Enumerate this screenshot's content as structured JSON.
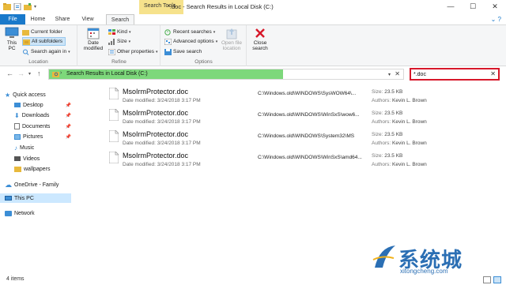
{
  "window": {
    "title": "*.doc - Search Results in Local Disk (C:)",
    "context_tab_group": "Search Tools",
    "controls": {
      "minimize": "—",
      "maximize": "☐",
      "close": "✕"
    }
  },
  "tabs": {
    "file": "File",
    "home": "Home",
    "share": "Share",
    "view": "View",
    "search": "Search"
  },
  "ribbon": {
    "location": {
      "label": "Location",
      "this_pc": "This PC",
      "current_folder": "Current folder",
      "all_subfolders": "All subfolders",
      "search_again_in": "Search again in"
    },
    "refine": {
      "label": "Refine",
      "date_modified": "Date modified",
      "kind": "Kind",
      "size": "Size",
      "other_properties": "Other properties"
    },
    "options": {
      "label": "Options",
      "recent_searches": "Recent searches",
      "advanced_options": "Advanced options",
      "save_search": "Save search",
      "open_file_location": "Open file location"
    },
    "close": {
      "close_search": "Close search"
    }
  },
  "address": {
    "path": "Search Results in Local Disk (C:)",
    "search_value": "*.doc",
    "clear_glyph": "✕",
    "progress_fraction": 0.66
  },
  "nav_pane": {
    "items": [
      {
        "label": "Quick access",
        "icon": "star-icon"
      },
      {
        "label": "Desktop",
        "icon": "desktop-icon",
        "pinned": true
      },
      {
        "label": "Downloads",
        "icon": "downloads-icon",
        "pinned": true
      },
      {
        "label": "Documents",
        "icon": "documents-icon",
        "pinned": true
      },
      {
        "label": "Pictures",
        "icon": "pictures-icon",
        "pinned": true
      },
      {
        "label": "Music",
        "icon": "music-icon"
      },
      {
        "label": "Videos",
        "icon": "videos-icon"
      },
      {
        "label": "wallpapers",
        "icon": "folder-icon"
      },
      {
        "label": "OneDrive - Family",
        "icon": "onedrive-icon"
      },
      {
        "label": "This PC",
        "icon": "computer-icon",
        "selected": true
      },
      {
        "label": "Network",
        "icon": "network-icon"
      }
    ]
  },
  "results": {
    "date_label": "Date modified:",
    "size_label": "Size:",
    "authors_label": "Authors:",
    "items": [
      {
        "name": "MsoIrmProtector.doc",
        "date": "3/24/2018 3:17 PM",
        "path": "C:\\Windows.old\\WINDOWS\\SysWOW64\\...",
        "size": "23.5 KB",
        "author": "Kevin L. Brown"
      },
      {
        "name": "MsoIrmProtector.doc",
        "date": "3/24/2018 3:17 PM",
        "path": "C:\\Windows.old\\WINDOWS\\WinSxS\\wow6...",
        "size": "23.5 KB",
        "author": "Kevin L. Brown"
      },
      {
        "name": "MsoIrmProtector.doc",
        "date": "3/24/2018 3:17 PM",
        "path": "C:\\Windows.old\\WINDOWS\\System32\\MS",
        "size": "23.5 KB",
        "author": "Kevin L. Brown"
      },
      {
        "name": "MsoIrmProtector.doc",
        "date": "3/24/2018 3:17 PM",
        "path": "C:\\Windows.old\\WINDOWS\\WinSxS\\amd64...",
        "size": "23.5 KB",
        "author": "Kevin L. Brown"
      }
    ]
  },
  "status": {
    "count": "4 items"
  },
  "watermark": {
    "cn": "系统城",
    "en": "xitongcheng.com"
  },
  "colors": {
    "accent": "#1979ca",
    "context_tab": "#f6e28c",
    "progress": "#7dd87b",
    "search_highlight": "#d7182a"
  }
}
